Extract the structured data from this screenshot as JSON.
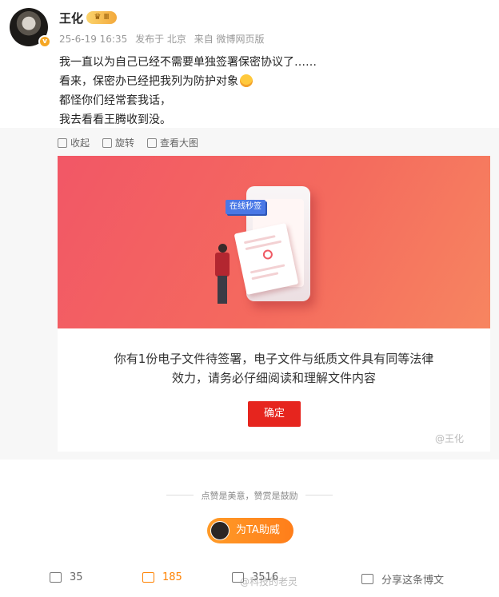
{
  "post": {
    "author": "王化",
    "badge": "⭐",
    "timestamp": "25-6-19 16:35",
    "location": "发布于 北京",
    "source": "来自 微博网页版",
    "lines": [
      "我一直以为自己已经不需要单独签署保密协议了……",
      "看来，保密办已经把我列为防护对象",
      "都怪你们经常套我话，",
      "我去看看王腾收到没。"
    ]
  },
  "media_toolbar": {
    "collapse": "收起",
    "rotate": "旋转",
    "view_large": "查看大图"
  },
  "doc": {
    "tag": "在线秒签",
    "message_line1": "你有1份电子文件待签署，电子文件与纸质文件具有同等法律",
    "message_line2": "效力，请务必仔细阅读和理解文件内容",
    "confirm": "确定",
    "watermark": "@王化"
  },
  "reward": {
    "slogan": "点赞是美意，赞赏是鼓励",
    "cheer": "为TA助威"
  },
  "actions": {
    "repost_count": "35",
    "comment_count": "185",
    "like_count": "3516",
    "share": "分享这条博文",
    "footer_watermark": "@科技的老灵"
  },
  "colors": {
    "accent": "#ff8200",
    "confirm": "#e6251e",
    "banner": "#f25766"
  }
}
